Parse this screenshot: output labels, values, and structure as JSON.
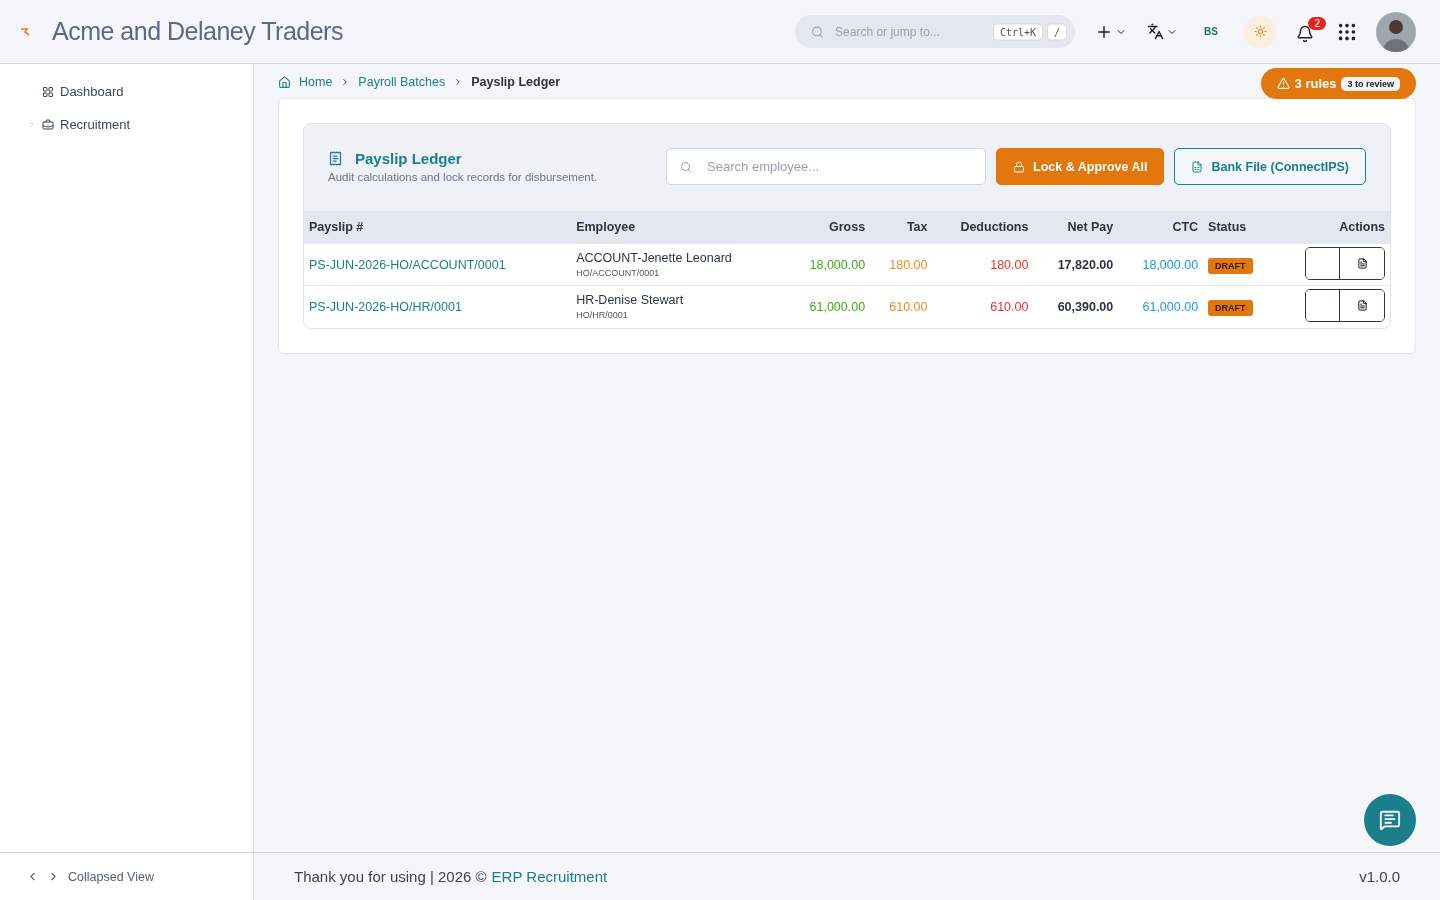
{
  "header": {
    "company": "Acme and Delaney Traders",
    "search": {
      "placeholder": "Search or jump to...",
      "shortcuts": [
        "Ctrl+K",
        "/"
      ]
    },
    "calendar_label": "BS",
    "notification_count": "2"
  },
  "sidebar": {
    "items": [
      {
        "label": "Dashboard",
        "kind": "link"
      },
      {
        "label": "Recruitment",
        "kind": "group"
      }
    ],
    "footer_label": "Collapsed View"
  },
  "breadcrumb": [
    "Home",
    "Payroll Batches",
    "Payslip Ledger"
  ],
  "rules_button": {
    "label": "3 rules",
    "badge": "3 to review"
  },
  "panel": {
    "title": "Payslip Ledger",
    "subtitle": "Audit calculations and lock records for disbursement.",
    "search": {
      "placeholder": "Search employee..."
    },
    "buttons": [
      {
        "label": "Lock & Approve All",
        "kind": "primary"
      },
      {
        "label": "Bank File (ConnectIPS)",
        "kind": "outline"
      }
    ]
  },
  "table": {
    "columns": [
      "Payslip #",
      "Employee",
      "Gross",
      "Tax",
      "Deductions",
      "Net Pay",
      "CTC",
      "Status",
      "Actions"
    ],
    "rows": [
      {
        "payslip": "PS-JUN-2026-HO/ACCOUNT/0001",
        "employee": "ACCOUNT-Jenette Leonard",
        "employee_code": "HO/ACCOUNT/0001",
        "gross": "18,000.00",
        "tax": "180.00",
        "deductions": "180.00",
        "net_pay": "17,820.00",
        "ctc": "18,000.00",
        "status": "DRAFT"
      },
      {
        "payslip": "PS-JUN-2026-HO/HR/0001",
        "employee": "HR-Denise Stewart",
        "employee_code": "HO/HR/0001",
        "gross": "61,000.00",
        "tax": "610.00",
        "deductions": "610.00",
        "net_pay": "60,390.00",
        "ctc": "61,000.00",
        "status": "DRAFT"
      }
    ]
  },
  "footer": {
    "text": "Thank you for using | 2026 ©",
    "link": "ERP Recruitment",
    "version": "v1.0.0"
  }
}
